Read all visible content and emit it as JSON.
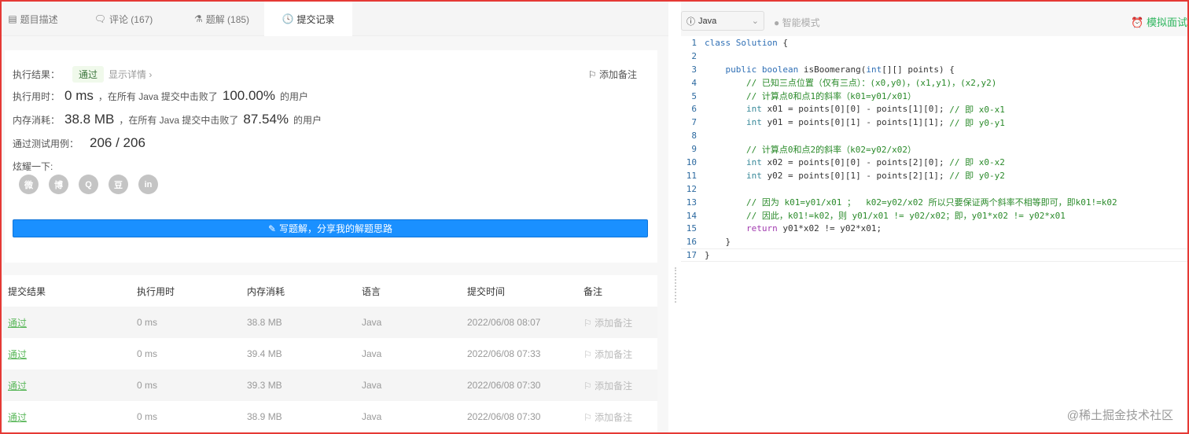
{
  "tabs": [
    {
      "label": "题目描述"
    },
    {
      "label": "评论 (167)"
    },
    {
      "label": "题解 (185)"
    },
    {
      "label": "提交记录"
    }
  ],
  "result": {
    "label_result": "执行结果：",
    "status": "通过",
    "detail": "显示详情 ›",
    "add_note": "添加备注",
    "label_time": "执行用时：",
    "time": "0 ms",
    "beat_text": "，在所有 Java 提交中击败了",
    "time_pct": "100.00%",
    "users": "的用户",
    "label_mem": "内存消耗：",
    "mem": "38.8 MB",
    "mem_pct": "87.54%",
    "label_tests": "通过测试用例：",
    "tests": "206 / 206",
    "label_share": "炫耀一下:",
    "write_button": "写题解，分享我的解题思路"
  },
  "shares": [
    {
      "icon": "wechat-icon",
      "glyph": "微"
    },
    {
      "icon": "weibo-icon",
      "glyph": "博"
    },
    {
      "icon": "qq-icon",
      "glyph": "Q"
    },
    {
      "icon": "douban-icon",
      "glyph": "豆"
    },
    {
      "icon": "linkedin-icon",
      "glyph": "in"
    }
  ],
  "table": {
    "headers": [
      "提交结果",
      "执行用时",
      "内存消耗",
      "语言",
      "提交时间",
      "备注"
    ],
    "rows": [
      {
        "status": "通过",
        "time": "0 ms",
        "mem": "38.8 MB",
        "lang": "Java",
        "date": "2022/06/08 08:07",
        "note": "添加备注"
      },
      {
        "status": "通过",
        "time": "0 ms",
        "mem": "39.4 MB",
        "lang": "Java",
        "date": "2022/06/08 07:33",
        "note": "添加备注"
      },
      {
        "status": "通过",
        "time": "0 ms",
        "mem": "39.3 MB",
        "lang": "Java",
        "date": "2022/06/08 07:30",
        "note": "添加备注"
      },
      {
        "status": "通过",
        "time": "0 ms",
        "mem": "38.9 MB",
        "lang": "Java",
        "date": "2022/06/08 07:30",
        "note": "添加备注"
      }
    ]
  },
  "editor": {
    "language": "Java",
    "smart_mode": "智能模式",
    "mock_interview": "模拟面试",
    "lines": [
      [
        [
          "kw",
          "class Solution "
        ],
        [
          "id",
          "{"
        ]
      ],
      [],
      [
        [
          "kw",
          "    public boolean "
        ],
        [
          "id",
          "isBoomerang("
        ],
        [
          "kw",
          "int"
        ],
        [
          "id",
          "[][] points) {"
        ]
      ],
      [
        [
          "cm",
          "        // 已知三点位置（仅有三点）：(x0,y0)，(x1,y1)，(x2,y2)"
        ]
      ],
      [
        [
          "cm",
          "        // 计算点0和点1的斜率（k01=y01/x01）"
        ]
      ],
      [
        [
          "ty",
          "        int "
        ],
        [
          "id",
          "x01 = points[0][0] - points[1][0]; "
        ],
        [
          "cm",
          "// 即 x0-x1"
        ]
      ],
      [
        [
          "ty",
          "        int "
        ],
        [
          "id",
          "y01 = points[0][1] - points[1][1]; "
        ],
        [
          "cm",
          "// 即 y0-y1"
        ]
      ],
      [],
      [
        [
          "cm",
          "        // 计算点0和点2的斜率（k02=y02/x02）"
        ]
      ],
      [
        [
          "ty",
          "        int "
        ],
        [
          "id",
          "x02 = points[0][0] - points[2][0]; "
        ],
        [
          "cm",
          "// 即 x0-x2"
        ]
      ],
      [
        [
          "ty",
          "        int "
        ],
        [
          "id",
          "y02 = points[0][1] - points[2][1]; "
        ],
        [
          "cm",
          "// 即 y0-y2"
        ]
      ],
      [],
      [
        [
          "cm",
          "        // 因为 k01=y01/x01 ；  k02=y02/x02 所以只要保证两个斜率不相等即可，即k01!=k02"
        ]
      ],
      [
        [
          "cm",
          "        // 因此，k01!=k02，则 y01/x01 != y02/x02；即，y01*x02 != y02*x01"
        ]
      ],
      [
        [
          "ret",
          "        return "
        ],
        [
          "id",
          "y01*x02 != y02*x01;"
        ]
      ],
      [
        [
          "id",
          "    }"
        ]
      ],
      [
        [
          "id",
          "}"
        ]
      ]
    ]
  },
  "watermark": "@稀土掘金技术社区"
}
